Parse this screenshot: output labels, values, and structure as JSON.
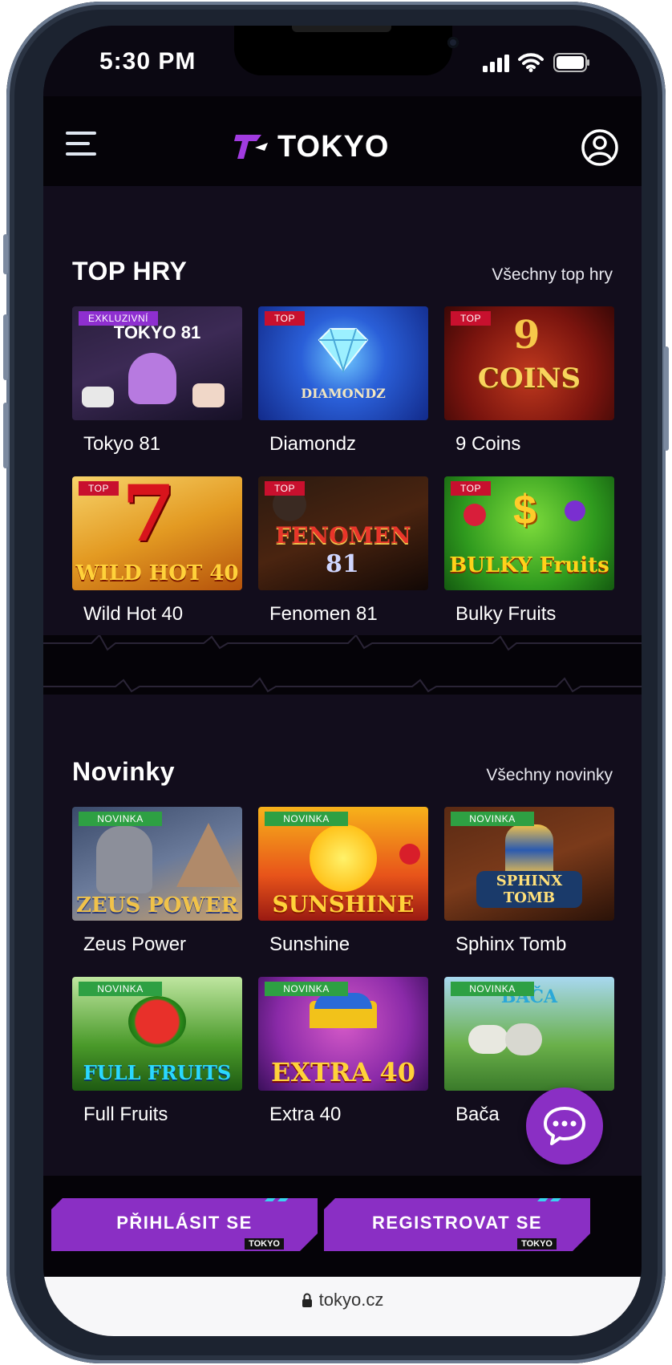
{
  "status_bar": {
    "time": "5:30 PM"
  },
  "header": {
    "logo_text": "TOKYO"
  },
  "sections": [
    {
      "title": "TOP HRY",
      "link": "Všechny top hry",
      "games": [
        {
          "name": "Tokyo 81",
          "badge": "EXKLUZIVNÍ",
          "thumb_text": "TOKYO 81"
        },
        {
          "name": "Diamondz",
          "badge": "TOP",
          "thumb_text": "DIAMONDZ"
        },
        {
          "name": "9 Coins",
          "badge": "TOP",
          "thumb_text": "COINS"
        },
        {
          "name": "Wild Hot 40",
          "badge": "TOP",
          "thumb_text": "WILD HOT 40"
        },
        {
          "name": "Fenomen 81",
          "badge": "TOP",
          "thumb_text": "FENOMEN"
        },
        {
          "name": "Bulky Fruits",
          "badge": "TOP",
          "thumb_text": "BULKY Fruits"
        }
      ]
    },
    {
      "title": "Novinky",
      "link": "Všechny novinky",
      "games": [
        {
          "name": "Zeus Power",
          "badge": "NOVINKA",
          "thumb_text": "ZEUS POWER"
        },
        {
          "name": "Sunshine",
          "badge": "NOVINKA",
          "thumb_text": "SUNSHINE"
        },
        {
          "name": "Sphinx Tomb",
          "badge": "NOVINKA",
          "thumb_text": "SPHINX TOMB"
        },
        {
          "name": "Full Fruits",
          "badge": "NOVINKA",
          "thumb_text": "FULL FRUITS"
        },
        {
          "name": "Extra 40",
          "badge": "NOVINKA",
          "thumb_text": "EXTRA 40"
        },
        {
          "name": "Bača",
          "badge": "NOVINKA",
          "thumb_text": "BAČA"
        }
      ]
    }
  ],
  "cta": {
    "login_label": "PŘIHLÁSIT SE",
    "register_label": "REGISTROVAT SE",
    "mark": "TOKYO"
  },
  "browser": {
    "url": "tokyo.cz"
  },
  "colors": {
    "accent": "#8a2fc4",
    "top_badge": "#c8102e",
    "new_badge": "#2ea043",
    "bg": "#120d1c"
  },
  "icons": [
    "menu-icon",
    "user-icon",
    "chat-icon",
    "lock-icon",
    "signal-icon",
    "wifi-icon",
    "battery-icon"
  ]
}
